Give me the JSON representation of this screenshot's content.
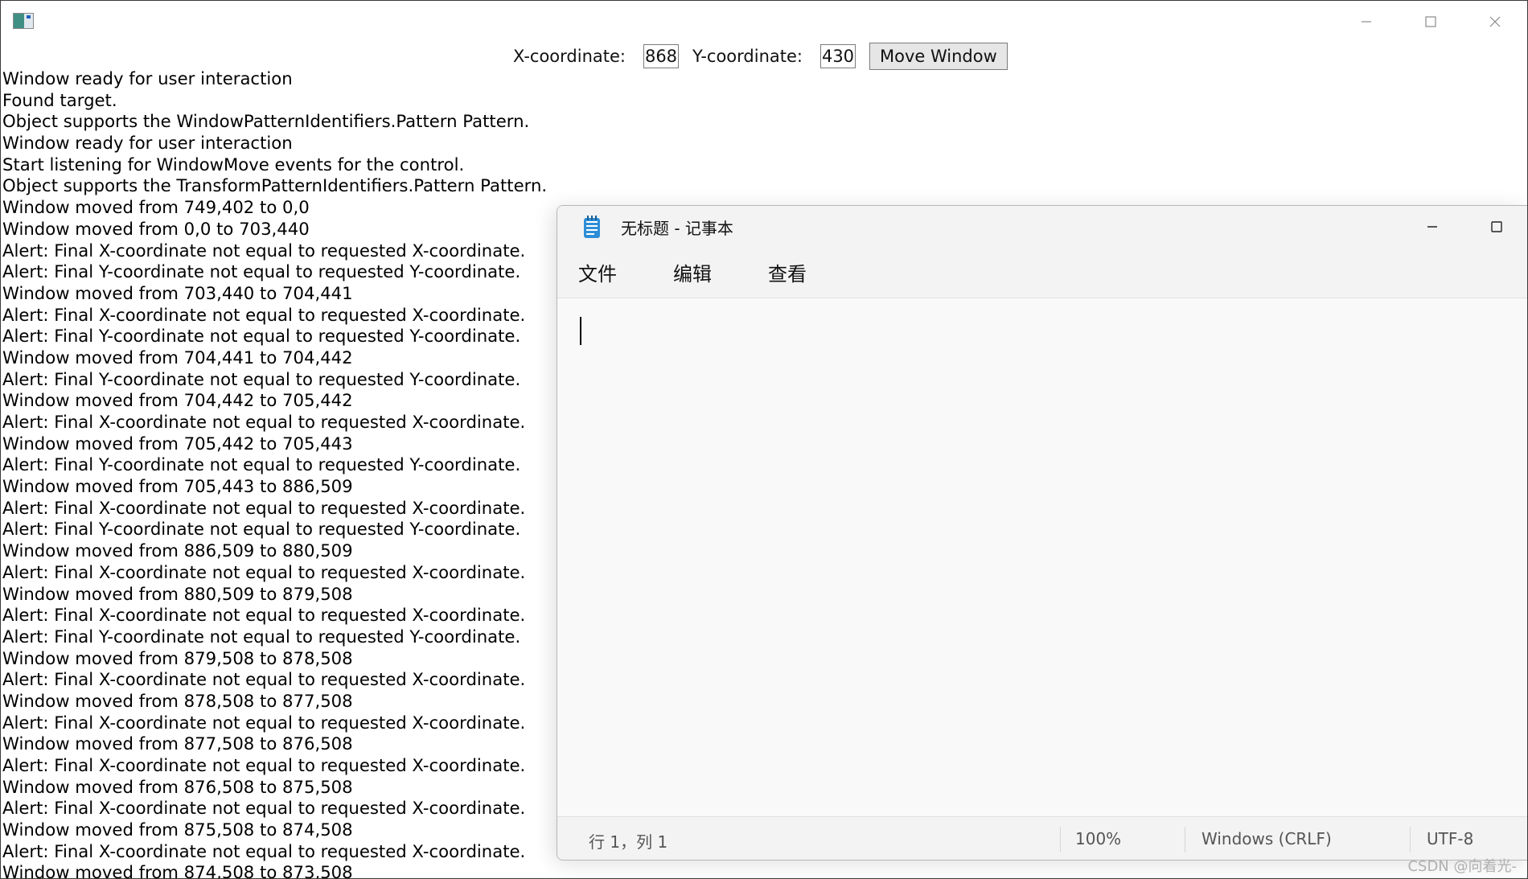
{
  "main_window": {
    "caption": {
      "minimize_icon": "minimize-icon",
      "maximize_icon": "maximize-icon",
      "close_icon": "close-icon"
    },
    "toolbar": {
      "x_label": "X-coordinate:",
      "x_value": "868",
      "y_label": "Y-coordinate:",
      "y_value": "430",
      "move_button_label": "Move Window"
    },
    "log": [
      "Window ready for user interaction",
      "Found target.",
      "Object supports the WindowPatternIdentifiers.Pattern Pattern.",
      "Window ready for user interaction",
      "Start listening for WindowMove events for the control.",
      "Object supports the TransformPatternIdentifiers.Pattern Pattern.",
      "Window moved from 749,402 to 0,0",
      "Window moved from 0,0 to 703,440",
      "Alert: Final X-coordinate not equal to requested X-coordinate.",
      "Alert: Final Y-coordinate not equal to requested Y-coordinate.",
      "Window moved from 703,440 to 704,441",
      "Alert: Final X-coordinate not equal to requested X-coordinate.",
      "Alert: Final Y-coordinate not equal to requested Y-coordinate.",
      "Window moved from 704,441 to 704,442",
      "Alert: Final Y-coordinate not equal to requested Y-coordinate.",
      "Window moved from 704,442 to 705,442",
      "Alert: Final X-coordinate not equal to requested X-coordinate.",
      "Window moved from 705,442 to 705,443",
      "Alert: Final Y-coordinate not equal to requested Y-coordinate.",
      "Window moved from 705,443 to 886,509",
      "Alert: Final X-coordinate not equal to requested X-coordinate.",
      "Alert: Final Y-coordinate not equal to requested Y-coordinate.",
      "Window moved from 886,509 to 880,509",
      "Alert: Final X-coordinate not equal to requested X-coordinate.",
      "Window moved from 880,509 to 879,508",
      "Alert: Final X-coordinate not equal to requested X-coordinate.",
      "Alert: Final Y-coordinate not equal to requested Y-coordinate.",
      "Window moved from 879,508 to 878,508",
      "Alert: Final X-coordinate not equal to requested X-coordinate.",
      "Window moved from 878,508 to 877,508",
      "Alert: Final X-coordinate not equal to requested X-coordinate.",
      "Window moved from 877,508 to 876,508",
      "Alert: Final X-coordinate not equal to requested X-coordinate.",
      "Window moved from 876,508 to 875,508",
      "Alert: Final X-coordinate not equal to requested X-coordinate.",
      "Window moved from 875,508 to 874,508",
      "Alert: Final X-coordinate not equal to requested X-coordinate.",
      "Window moved from 874,508 to 873,508"
    ]
  },
  "notepad": {
    "title": "无标题 - 记事本",
    "app_icon": "notepad-icon",
    "menu": [
      "文件",
      "编辑",
      "查看"
    ],
    "status": {
      "position": "行 1，列 1",
      "zoom": "100%",
      "line_ending": "Windows (CRLF)",
      "encoding": "UTF-8"
    }
  },
  "watermark": "CSDN @向着光-",
  "colors": {
    "window_border": "#3a3a3a",
    "button_face": "#e6e6e6",
    "notepad_background": "#f9f9f9",
    "notepad_chrome": "#f3f3f3",
    "notepad_icon_blue": "#2d8ed8"
  }
}
